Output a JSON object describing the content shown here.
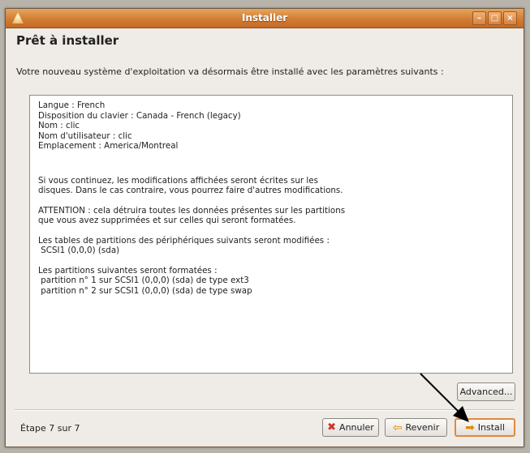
{
  "window": {
    "title": "Installer",
    "controls": [
      "minimize",
      "maximize",
      "close"
    ]
  },
  "page": {
    "heading": "Prêt à installer",
    "intro": "Votre nouveau système d'exploitation va désormais être installé avec les paramètres suivants :"
  },
  "summary": {
    "settings": [
      "Langue : French",
      "Disposition du clavier : Canada - French (legacy)",
      "Nom : clic",
      "Nom d'utilisateur : clic",
      "Emplacement : America/Montreal"
    ],
    "continue_1": "Si vous continuez, les modifications affichées seront écrites sur les",
    "continue_2": "disques. Dans le cas contraire, vous pourrez faire d'autres modifications.",
    "warning_1": "ATTENTION : cela détruira toutes les données présentes sur les partitions",
    "warning_2": "que vous avez supprimées et sur celles qui seront formatées.",
    "tables_heading": "Les tables de partitions des périphériques suivants seront modifiées :",
    "tables_device": " SCSI1 (0,0,0) (sda)",
    "format_heading": "Les partitions suivantes seront formatées :",
    "format_items": [
      " partition n° 1 sur SCSI1 (0,0,0) (sda) de type ext3",
      " partition n° 2 sur SCSI1 (0,0,0) (sda) de type swap"
    ]
  },
  "buttons": {
    "advanced": "Advanced...",
    "cancel": "Annuler",
    "back": "Revenir",
    "install": "Install"
  },
  "footer": {
    "step": "Étape 7 sur 7"
  },
  "colors": {
    "titlebar": "#d27c33",
    "window_bg": "#efebe7",
    "install_highlight": "#e08a3c"
  }
}
